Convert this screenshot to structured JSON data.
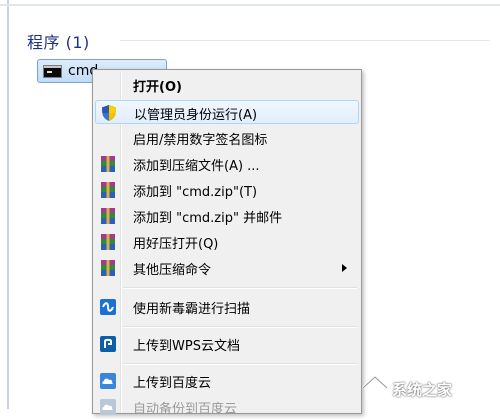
{
  "section": {
    "title": "程序 (1)"
  },
  "result": {
    "label": "cmd",
    "icon": "cmd-console-icon"
  },
  "menu": {
    "items": [
      {
        "label": "打开(O)",
        "icon": "",
        "bold": true
      },
      {
        "label": "以管理员身份运行(A)",
        "icon": "uac-shield-icon",
        "hover": true
      },
      {
        "label": "启用/禁用数字签名图标",
        "icon": ""
      },
      {
        "label": "添加到压缩文件(A) ...",
        "icon": "winrar-icon"
      },
      {
        "label": "添加到 \"cmd.zip\"(T)",
        "icon": "winrar-icon"
      },
      {
        "label": "添加到 \"cmd.zip\" 并邮件",
        "icon": "winrar-icon"
      },
      {
        "label": "用好压打开(Q)",
        "icon": "winrar-icon"
      },
      {
        "label": "其他压缩命令",
        "icon": "winrar-icon",
        "submenu": true
      },
      {
        "label": "使用新毒霸进行扫描",
        "icon": "duba-icon"
      },
      {
        "label": "上传到WPS云文档",
        "icon": "wps-cloud-icon"
      },
      {
        "label": "上传到百度云",
        "icon": "baidu-cloud-icon"
      },
      {
        "label": "自动备份到百度云",
        "icon": "baidu-cloud-icon",
        "disabled": true
      }
    ]
  },
  "watermark": {
    "text": "系统之家",
    "icon": "house-logo-icon"
  },
  "colors": {
    "section_title": "#1e3287",
    "selection": "#c3dcf5",
    "menu_bg": "#f0f0f0",
    "hover_border": "#a8d8fb"
  }
}
